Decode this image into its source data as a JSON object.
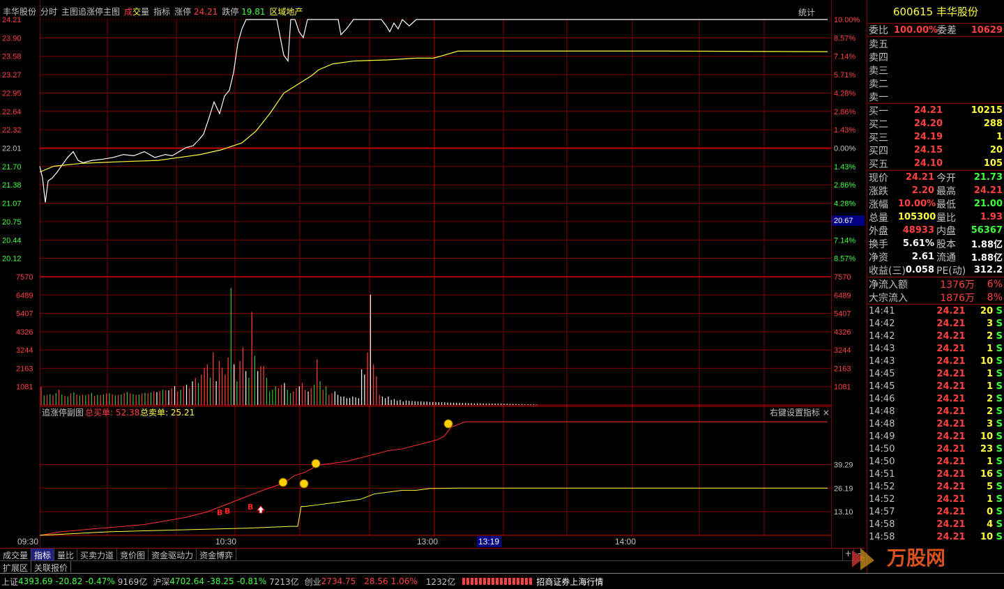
{
  "header": {
    "stock_name": "丰华股份",
    "tab_fenshi": "分时",
    "tab_main_chart": "主图追涨停主图",
    "volume_prefix": "成",
    "volume_mid": "交",
    "volume_suffix": "量",
    "indicator": "指标",
    "limit_up_label": "涨停",
    "limit_up_value": "24.21",
    "limit_down_label": "跌停",
    "limit_down_value": "19.81",
    "sector": "区域地产",
    "stats_button": "统计"
  },
  "chart_data": {
    "type": "line",
    "price_axis_left": [
      "24.21",
      "23.90",
      "23.58",
      "23.27",
      "22.95",
      "22.64",
      "22.32",
      "22.01",
      "21.70",
      "21.38",
      "21.07",
      "20.75",
      "20.44",
      "20.12"
    ],
    "pct_axis_right": [
      "10.00%",
      "8.57%",
      "7.14%",
      "5.71%",
      "4.28%",
      "2.86%",
      "1.43%",
      "0.00%",
      "1.43%",
      "2.86%",
      "4.28%",
      "5.71%",
      "7.14%",
      "8.57%"
    ],
    "prev_close": 22.01,
    "cursor_value": "20.67",
    "volume_axis": [
      "7570",
      "6489",
      "5407",
      "4326",
      "3244",
      "2163",
      "1081"
    ],
    "sub_indicator_title": "追涨停副图",
    "sub_buy_label": "总买单:",
    "sub_buy_value": "52.38",
    "sub_sell_label": "总卖单:",
    "sub_sell_value": "25.21",
    "sub_settings": "右键设置指标",
    "sub_axis": [
      "39.29",
      "26.19",
      "13.10"
    ],
    "time_labels": [
      "09:30",
      "10:30",
      "13:00",
      "14:00"
    ],
    "cursor_time": "13:19",
    "price_series": [
      [
        0,
        21.7
      ],
      [
        4,
        21.5
      ],
      [
        8,
        21.08
      ],
      [
        12,
        21.45
      ],
      [
        18,
        21.5
      ],
      [
        25,
        21.6
      ],
      [
        32,
        21.72
      ],
      [
        40,
        21.85
      ],
      [
        48,
        21.95
      ],
      [
        55,
        21.8
      ],
      [
        62,
        21.76
      ],
      [
        75,
        21.8
      ],
      [
        90,
        21.82
      ],
      [
        105,
        21.85
      ],
      [
        120,
        21.9
      ],
      [
        135,
        21.88
      ],
      [
        150,
        21.95
      ],
      [
        165,
        21.85
      ],
      [
        180,
        21.9
      ],
      [
        190,
        21.88
      ],
      [
        200,
        21.95
      ],
      [
        210,
        22.02
      ],
      [
        220,
        22.05
      ],
      [
        228,
        22.15
      ],
      [
        235,
        22.25
      ],
      [
        242,
        22.5
      ],
      [
        250,
        22.8
      ],
      [
        258,
        22.6
      ],
      [
        265,
        22.9
      ],
      [
        272,
        23.0
      ],
      [
        278,
        23.3
      ],
      [
        284,
        23.8
      ],
      [
        290,
        24.05
      ],
      [
        296,
        24.21
      ],
      [
        310,
        24.21
      ],
      [
        330,
        24.21
      ],
      [
        340,
        24.21
      ],
      [
        345,
        23.9
      ],
      [
        350,
        23.6
      ],
      [
        356,
        23.5
      ],
      [
        360,
        24.21
      ],
      [
        366,
        24.21
      ],
      [
        372,
        24.0
      ],
      [
        378,
        23.9
      ],
      [
        384,
        24.21
      ],
      [
        390,
        24.21
      ],
      [
        400,
        24.21
      ],
      [
        410,
        24.21
      ],
      [
        420,
        24.21
      ],
      [
        428,
        24.21
      ],
      [
        432,
        23.95
      ],
      [
        440,
        24.05
      ],
      [
        450,
        24.21
      ],
      [
        460,
        24.21
      ],
      [
        470,
        24.21
      ],
      [
        480,
        24.21
      ],
      [
        490,
        24.21
      ],
      [
        497,
        24.1
      ],
      [
        502,
        24.0
      ],
      [
        508,
        24.15
      ],
      [
        514,
        24.05
      ],
      [
        520,
        24.21
      ],
      [
        530,
        24.1
      ],
      [
        540,
        24.21
      ],
      [
        580,
        24.21
      ],
      [
        700,
        24.21
      ],
      [
        1130,
        24.21
      ]
    ],
    "avg_series": [
      [
        0,
        21.6
      ],
      [
        20,
        21.7
      ],
      [
        60,
        21.75
      ],
      [
        120,
        21.78
      ],
      [
        170,
        21.8
      ],
      [
        200,
        21.85
      ],
      [
        230,
        21.9
      ],
      [
        260,
        21.98
      ],
      [
        290,
        22.1
      ],
      [
        310,
        22.3
      ],
      [
        330,
        22.6
      ],
      [
        350,
        22.95
      ],
      [
        370,
        23.1
      ],
      [
        390,
        23.25
      ],
      [
        400,
        23.35
      ],
      [
        420,
        23.45
      ],
      [
        450,
        23.5
      ],
      [
        500,
        23.52
      ],
      [
        540,
        23.55
      ],
      [
        565,
        23.55
      ],
      [
        580,
        23.6
      ],
      [
        600,
        23.67
      ],
      [
        700,
        23.67
      ],
      [
        900,
        23.67
      ],
      [
        1130,
        23.66
      ]
    ],
    "volume_series": [
      1081,
      560,
      600,
      640,
      580,
      700,
      900,
      620,
      540,
      500,
      680,
      750,
      620,
      560,
      600,
      580,
      640,
      720,
      540,
      600,
      580,
      620,
      680,
      700,
      640,
      560,
      600,
      620,
      700,
      760,
      680,
      640,
      600,
      620,
      680,
      720,
      700,
      740,
      800,
      760,
      820,
      900,
      880,
      860,
      980,
      1120,
      800,
      900,
      1100,
      1200,
      1000,
      1400,
      1600,
      1300,
      1800,
      2200,
      2400,
      1600,
      3100,
      1400,
      2600,
      2200,
      1800,
      2800,
      6900,
      2400,
      1400,
      2600,
      3400,
      2000,
      1600,
      5500,
      2900,
      2000,
      2300,
      2300,
      1600,
      800,
      900,
      1100,
      1000,
      1200,
      1300,
      900,
      700,
      800,
      1000,
      1100,
      1300,
      900,
      800,
      1000,
      1200,
      2700,
      1400,
      900,
      1100,
      600,
      700,
      800,
      600,
      500,
      500,
      400,
      420,
      500,
      450,
      400,
      2100,
      1800,
      3100,
      6500,
      2400,
      1700,
      600,
      500,
      400,
      500,
      300,
      350,
      250,
      300,
      200,
      260,
      240,
      230,
      220,
      210,
      220,
      200,
      200,
      180,
      180,
      170,
      160,
      160,
      150,
      150,
      140,
      140,
      130,
      130,
      120,
      120,
      110,
      110,
      100,
      100,
      100,
      90,
      90,
      90,
      90,
      80,
      80,
      80,
      70,
      70,
      60,
      60,
      60,
      50,
      50,
      40,
      40,
      40,
      30,
      30
    ],
    "volume_colors": [
      "r",
      "g",
      "r",
      "g",
      "r",
      "g",
      "r",
      "g",
      "r",
      "g",
      "r",
      "g",
      "r",
      "g",
      "r",
      "g",
      "r",
      "g",
      "r",
      "g",
      "r",
      "g",
      "r",
      "g",
      "r",
      "g",
      "r",
      "g",
      "r",
      "g",
      "r",
      "g",
      "r",
      "g",
      "r",
      "g",
      "r",
      "g",
      "r",
      "w",
      "r",
      "g",
      "r",
      "w",
      "r",
      "w",
      "r",
      "g",
      "r",
      "w",
      "r",
      "w",
      "r",
      "g",
      "r",
      "r",
      "r",
      "g",
      "r",
      "w",
      "r",
      "r",
      "r",
      "r",
      "g",
      "w",
      "g",
      "r",
      "r",
      "w",
      "g",
      "r",
      "g",
      "w",
      "r",
      "r",
      "g",
      "g",
      "g",
      "g",
      "r",
      "r",
      "w",
      "g",
      "g",
      "r",
      "r",
      "w",
      "r",
      "r",
      "w",
      "r",
      "g",
      "r",
      "g",
      "r",
      "g",
      "r",
      "r",
      "w",
      "w",
      "w",
      "w",
      "w",
      "w",
      "w",
      "w",
      "w",
      "w",
      "w",
      "r",
      "w",
      "r",
      "r",
      "r",
      "w",
      "w",
      "w",
      "w",
      "w",
      "w",
      "w",
      "w",
      "w",
      "w",
      "w",
      "w",
      "w",
      "w",
      "w",
      "w",
      "w",
      "w",
      "w",
      "w",
      "w",
      "w",
      "w",
      "w",
      "w",
      "w",
      "w",
      "w",
      "w",
      "w",
      "w",
      "w",
      "w",
      "w",
      "w",
      "w",
      "w",
      "w",
      "w",
      "w",
      "w",
      "w",
      "w",
      "w",
      "w",
      "w",
      "w",
      "w",
      "w",
      "w"
    ],
    "buy_series": [
      [
        0,
        0
      ],
      [
        30,
        2
      ],
      [
        60,
        3
      ],
      [
        90,
        4
      ],
      [
        120,
        5
      ],
      [
        150,
        6
      ],
      [
        180,
        8
      ],
      [
        210,
        10
      ],
      [
        240,
        13
      ],
      [
        260,
        16
      ],
      [
        280,
        19
      ],
      [
        300,
        22
      ],
      [
        320,
        25
      ],
      [
        335,
        27
      ],
      [
        350,
        29
      ],
      [
        365,
        33
      ],
      [
        380,
        35
      ],
      [
        390,
        37
      ],
      [
        400,
        39
      ],
      [
        420,
        40
      ],
      [
        440,
        41
      ],
      [
        460,
        43
      ],
      [
        480,
        45
      ],
      [
        500,
        47
      ],
      [
        520,
        48
      ],
      [
        540,
        50
      ],
      [
        560,
        52
      ],
      [
        570,
        53
      ],
      [
        580,
        55
      ],
      [
        590,
        60
      ],
      [
        610,
        63
      ],
      [
        700,
        63
      ],
      [
        900,
        63
      ],
      [
        1130,
        63
      ]
    ],
    "sell_series": [
      [
        0,
        0
      ],
      [
        100,
        2
      ],
      [
        200,
        3
      ],
      [
        300,
        4
      ],
      [
        360,
        5
      ],
      [
        370,
        5
      ],
      [
        375,
        16
      ],
      [
        380,
        16
      ],
      [
        400,
        17
      ],
      [
        420,
        18
      ],
      [
        440,
        19
      ],
      [
        460,
        20
      ],
      [
        480,
        23
      ],
      [
        500,
        24
      ],
      [
        520,
        25
      ],
      [
        540,
        25
      ],
      [
        560,
        26
      ],
      [
        600,
        26.19
      ],
      [
        700,
        26.19
      ],
      [
        900,
        26.19
      ],
      [
        1130,
        26.19
      ]
    ]
  },
  "bottom_tabs": [
    "成交量",
    "指标",
    "量比",
    "买卖力道",
    "竞价图",
    "资金驱动力",
    "资金博弈"
  ],
  "bottom_tabs2": [
    "扩展区",
    "关联报价"
  ],
  "nav_plus": "+",
  "nav_minus": "-",
  "quote": {
    "code": "600615",
    "name": "丰华股份",
    "weibi_label": "委比",
    "weibi_value": "100.00%",
    "weicha_label": "委差",
    "weicha_value": "10629",
    "sell_labels": [
      "卖五",
      "卖四",
      "卖三",
      "卖二",
      "卖一"
    ],
    "buys": [
      {
        "label": "买一",
        "price": "24.21",
        "vol": "10215"
      },
      {
        "label": "买二",
        "price": "24.20",
        "vol": "288"
      },
      {
        "label": "买三",
        "price": "24.19",
        "vol": "1"
      },
      {
        "label": "买四",
        "price": "24.15",
        "vol": "20"
      },
      {
        "label": "买五",
        "price": "24.10",
        "vol": "105"
      }
    ],
    "stats": [
      {
        "l1": "现价",
        "v1": "24.21",
        "c1": "r",
        "l2": "今开",
        "v2": "21.73",
        "c2": "g"
      },
      {
        "l1": "涨跌",
        "v1": "2.20",
        "c1": "r",
        "l2": "最高",
        "v2": "24.21",
        "c2": "r"
      },
      {
        "l1": "涨幅",
        "v1": "10.00%",
        "c1": "r",
        "l2": "最低",
        "v2": "21.00",
        "c2": "g"
      },
      {
        "l1": "总量",
        "v1": "105300",
        "c1": "y",
        "l2": "量比",
        "v2": "1.93",
        "c2": "r"
      },
      {
        "l1": "外盘",
        "v1": "48933",
        "c1": "r",
        "l2": "内盘",
        "v2": "56367",
        "c2": "g"
      },
      {
        "l1": "换手",
        "v1": "5.61%",
        "c1": "w",
        "l2": "股本",
        "v2": "1.88亿",
        "c2": "w"
      },
      {
        "l1": "净资",
        "v1": "2.61",
        "c1": "w",
        "l2": "流通",
        "v2": "1.88亿",
        "c2": "w"
      },
      {
        "l1": "收益(三)",
        "v1": "0.058",
        "c1": "w",
        "l2": "PE(动)",
        "v2": "312.2",
        "c2": "w"
      }
    ],
    "flow": [
      {
        "label": "净流入额",
        "value": "1376万",
        "pct": "6%"
      },
      {
        "label": "大宗流入",
        "value": "1876万",
        "pct": "8%"
      }
    ],
    "ticks": [
      {
        "t": "14:41",
        "p": "24.21",
        "v": "20",
        "s": "S"
      },
      {
        "t": "14:42",
        "p": "24.21",
        "v": "3",
        "s": "S"
      },
      {
        "t": "14:42",
        "p": "24.21",
        "v": "2",
        "s": "S"
      },
      {
        "t": "14:43",
        "p": "24.21",
        "v": "1",
        "s": "S"
      },
      {
        "t": "14:43",
        "p": "24.21",
        "v": "10",
        "s": "S"
      },
      {
        "t": "14:45",
        "p": "24.21",
        "v": "1",
        "s": "S"
      },
      {
        "t": "14:45",
        "p": "24.21",
        "v": "1",
        "s": "S"
      },
      {
        "t": "14:46",
        "p": "24.21",
        "v": "2",
        "s": "S"
      },
      {
        "t": "14:48",
        "p": "24.21",
        "v": "2",
        "s": "S"
      },
      {
        "t": "14:48",
        "p": "24.21",
        "v": "3",
        "s": "S"
      },
      {
        "t": "14:49",
        "p": "24.21",
        "v": "10",
        "s": "S"
      },
      {
        "t": "14:50",
        "p": "24.21",
        "v": "23",
        "s": "S"
      },
      {
        "t": "14:50",
        "p": "24.21",
        "v": "1",
        "s": "S"
      },
      {
        "t": "14:51",
        "p": "24.21",
        "v": "16",
        "s": "S"
      },
      {
        "t": "14:52",
        "p": "24.21",
        "v": "5",
        "s": "S"
      },
      {
        "t": "14:52",
        "p": "24.21",
        "v": "1",
        "s": "S"
      },
      {
        "t": "14:57",
        "p": "24.21",
        "v": "0",
        "s": "S"
      },
      {
        "t": "14:58",
        "p": "24.21",
        "v": "4",
        "s": "S"
      },
      {
        "t": "14:58",
        "p": "24.21",
        "v": "10",
        "s": "S"
      }
    ]
  },
  "status": {
    "sh_label": "上证",
    "sh_value": "4393.69",
    "sh_change": "-20.82",
    "sh_pct": "-0.47%",
    "sh_amount": "9169亿",
    "sz_label": "沪深",
    "sz_value": "4702.64",
    "sz_change": "-38.25",
    "sz_pct": "-0.81%",
    "sz_amount": "7213亿",
    "cy_label": "创业",
    "cy_value": "2734.75",
    "cy_change": "28.56",
    "cy_pct": "1.06%",
    "cy_amount": "1232亿",
    "broker": "招商证券上海行情"
  },
  "watermark": "万股网"
}
